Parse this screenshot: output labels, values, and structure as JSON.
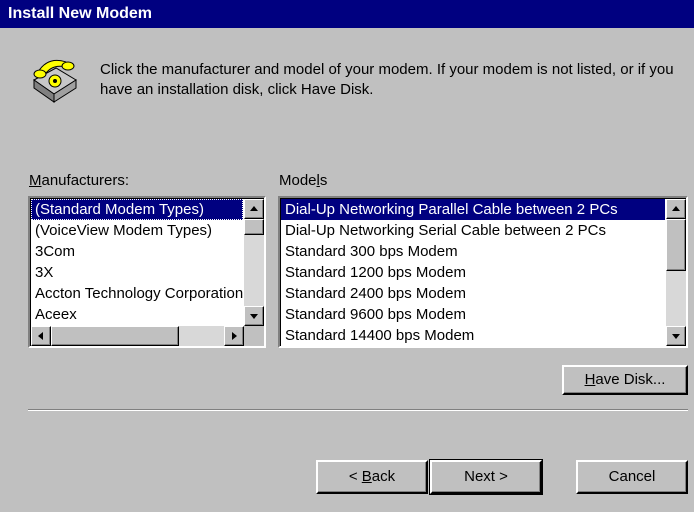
{
  "window": {
    "title": "Install New Modem"
  },
  "instruction": "Click the manufacturer and model of your modem. If your modem is not listed, or if you have an installation disk, click Have Disk.",
  "manufacturers": {
    "label_prefix": "",
    "label_mnemonic": "M",
    "label_rest": "anufacturers:",
    "items": [
      "(Standard Modem Types)",
      "(VoiceView Modem Types)",
      "3Com",
      "3X",
      "Accton Technology Corporation",
      "Aceex"
    ]
  },
  "models": {
    "label_prefix": "Mode",
    "label_mnemonic": "l",
    "label_rest": "s",
    "items": [
      "Dial-Up Networking Parallel Cable between 2 PCs",
      "Dial-Up Networking Serial Cable between 2 PCs",
      "Standard   300 bps Modem",
      "Standard  1200 bps Modem",
      "Standard  2400 bps Modem",
      "Standard  9600 bps Modem",
      "Standard 14400 bps Modem"
    ]
  },
  "buttons": {
    "have_disk_mnemonic": "H",
    "have_disk_rest": "ave Disk...",
    "back_prefix": "< ",
    "back_mnemonic": "B",
    "back_rest": "ack",
    "next": "Next >",
    "cancel": "Cancel"
  },
  "colors": {
    "face": "#c0c0c0",
    "title_bar": "#000080",
    "selection": "#000080"
  }
}
